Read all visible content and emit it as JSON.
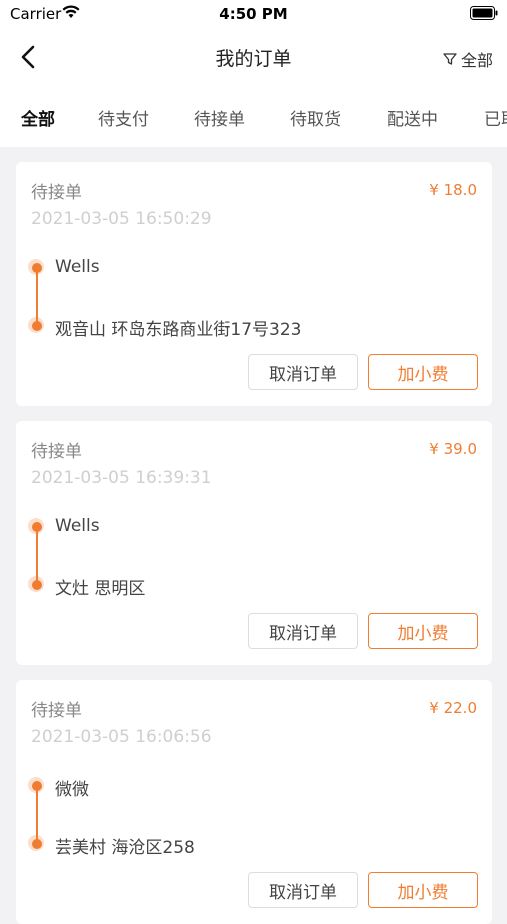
{
  "status_bar": {
    "carrier": "Carrier",
    "time": "4:50 PM"
  },
  "nav": {
    "title": "我的订单",
    "filter_label": "全部"
  },
  "tabs": [
    {
      "label": "全部",
      "active": true
    },
    {
      "label": "待支付"
    },
    {
      "label": "待接单"
    },
    {
      "label": "待取货"
    },
    {
      "label": "配送中"
    },
    {
      "label": "已取"
    }
  ],
  "orders": [
    {
      "status": "待接单",
      "price": "¥ 18.0",
      "time": "2021-03-05 16:50:29",
      "from": "Wells",
      "to": "观音山 环岛东路商业街17号323",
      "cancel_label": "取消订单",
      "fee_label": "加小费"
    },
    {
      "status": "待接单",
      "price": "¥ 39.0",
      "time": "2021-03-05 16:39:31",
      "from": "Wells",
      "to": "文灶 思明区",
      "cancel_label": "取消订单",
      "fee_label": "加小费"
    },
    {
      "status": "待接单",
      "price": "¥ 22.0",
      "time": "2021-03-05 16:06:56",
      "from": "微微",
      "to": "芸美村 海沧区258",
      "cancel_label": "取消订单",
      "fee_label": "加小费"
    }
  ],
  "colors": {
    "accent": "#f07d32",
    "tab_underline": "#f7c22f"
  }
}
